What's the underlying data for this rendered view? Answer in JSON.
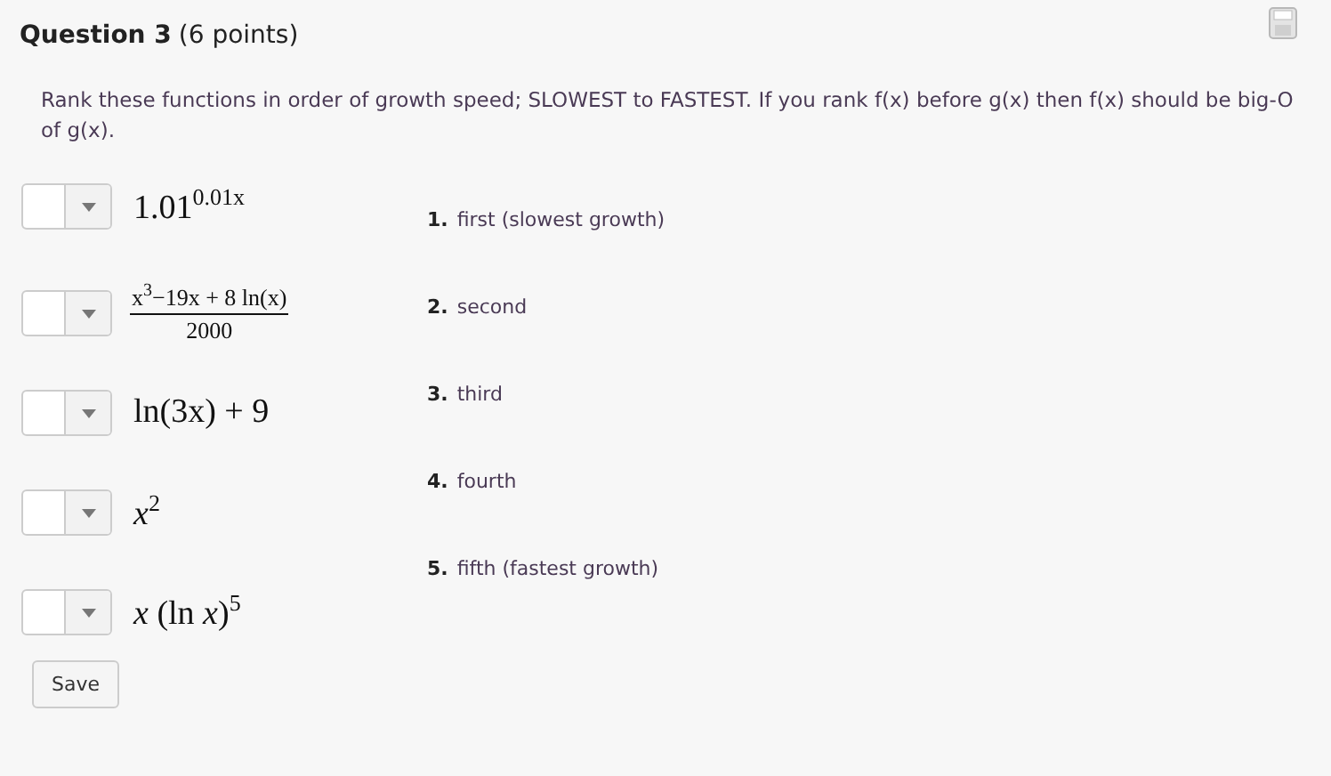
{
  "question": {
    "title": "Question 3",
    "points": "(6 points)"
  },
  "prompt": "Rank these functions in order of growth speed; SLOWEST to FASTEST. If you rank f(x) before g(x) then f(x) should be big-O of g(x).",
  "items": [
    {
      "kind": "inline",
      "expr": "1.01$^{0.01x}$"
    },
    {
      "kind": "fraction",
      "numerator": "x$^{3}$−19x + 8 ln(x)",
      "denominator": "2000"
    },
    {
      "kind": "inline",
      "expr": "ln(3x) + 9"
    },
    {
      "kind": "inline",
      "expr": "*x*$^{2}$"
    },
    {
      "kind": "inline",
      "expr": "*x* (ln *x*)$^{5}$"
    }
  ],
  "choices": [
    {
      "number": "1.",
      "label": "first (slowest growth)"
    },
    {
      "number": "2.",
      "label": "second"
    },
    {
      "number": "3.",
      "label": "third"
    },
    {
      "number": "4.",
      "label": "fourth"
    },
    {
      "number": "5.",
      "label": "fifth (fastest growth)"
    }
  ],
  "save_button": "Save"
}
